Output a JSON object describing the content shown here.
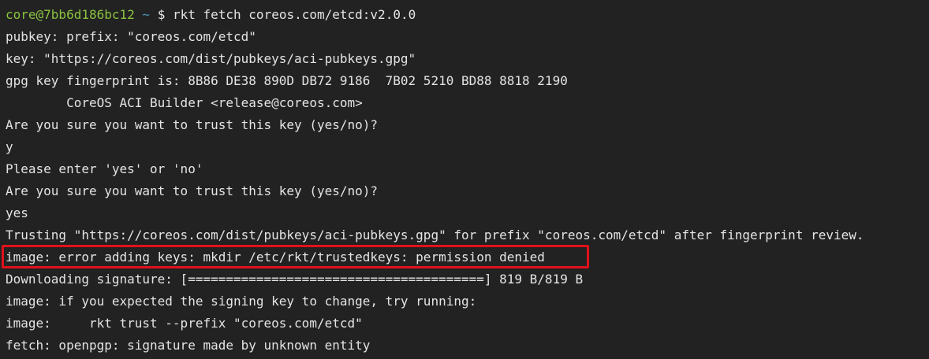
{
  "prompt": {
    "user_host": "core@7bb6d186bc12",
    "path": "~",
    "symbol": "$",
    "command": "rkt fetch coreos.com/etcd:v2.0.0"
  },
  "output_lines": [
    "pubkey: prefix: \"coreos.com/etcd\"",
    "key: \"https://coreos.com/dist/pubkeys/aci-pubkeys.gpg\"",
    "gpg key fingerprint is: 8B86 DE38 890D DB72 9186  7B02 5210 BD88 8818 2190",
    "        CoreOS ACI Builder <release@coreos.com>",
    "Are you sure you want to trust this key (yes/no)?",
    "y",
    "Please enter 'yes' or 'no'",
    "Are you sure you want to trust this key (yes/no)?",
    "yes",
    "Trusting \"https://coreos.com/dist/pubkeys/aci-pubkeys.gpg\" for prefix \"coreos.com/etcd\" after fingerprint review.",
    "image: error adding keys: mkdir /etc/rkt/trustedkeys: permission denied",
    "Downloading signature: [=======================================] 819 B/819 B",
    "image: if you expected the signing key to change, try running:",
    "image:     rkt trust --prefix \"coreos.com/etcd\"",
    "fetch: openpgp: signature made by unknown entity"
  ],
  "colors": {
    "background": "#222222",
    "text": "#e4e4e4",
    "prompt_user": "#8ac33f",
    "prompt_path": "#4e95b6",
    "highlight_border": "#e3101a"
  }
}
